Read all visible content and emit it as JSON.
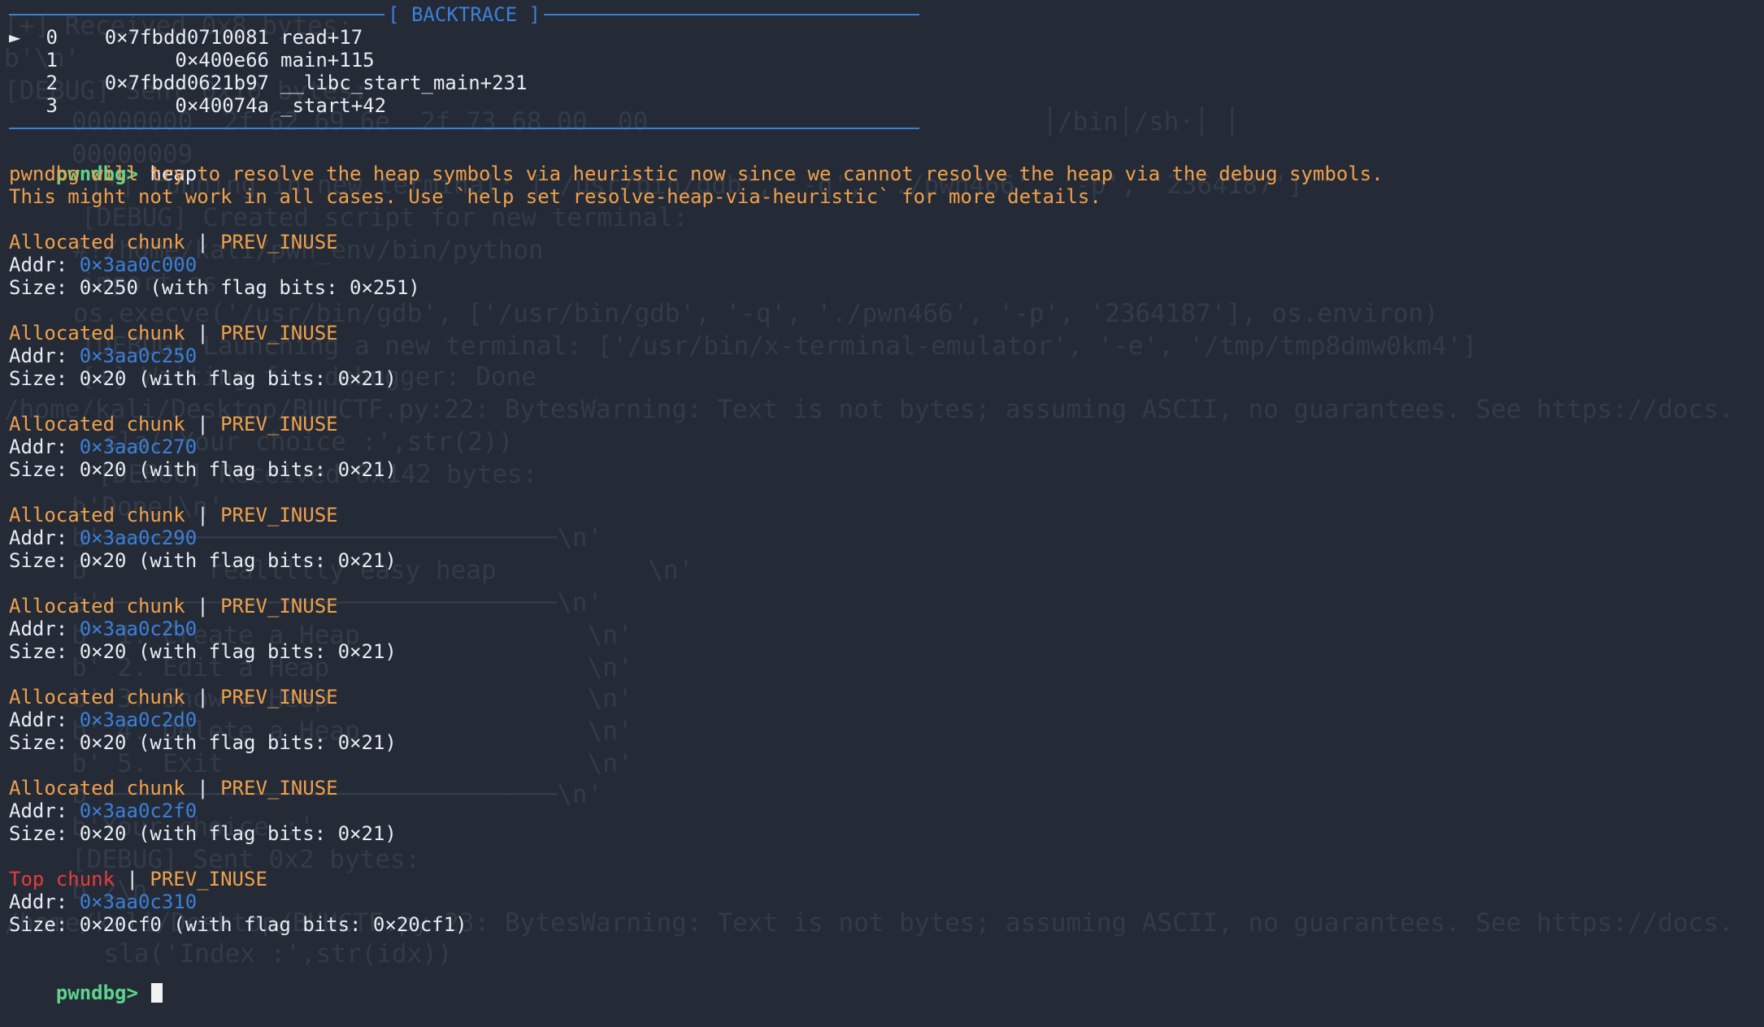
{
  "ghost_lines": [
    "[+] Received 0x8 bytes:",
    "b'\\n'",
    "[DEBUG] Sent 0x10 bytes:",
    "00000000  2f 62 69 6e  2f 73 68 00  00                          │/bin│/sh·│ │",
    "00000009",
    "[*] running in new terminal: ['/usr/bin/gdb', '-q', './pwn466', '-p', '2364187']",
    "[DEBUG] Created script for new terminal:",
    "#!/home/kali/pwn_env/bin/python",
    "import os",
    "os.execve('/usr/bin/gdb', ['/usr/bin/gdb', '-q', './pwn466', '-p', '2364187'], os.environ)",
    "[DEBUG] Launching a new terminal: ['/usr/bin/x-terminal-emulator', '-e', '/tmp/tmp8dmw0km4']",
    "[+] Waiting for debugger: Done",
    "/home/kali/Desktop/BUUCTF.py:22: BytesWarning: Text is not bytes; assuming ASCII, no guarantees. See https://docs.",
    "  sla('Your choice :',str(2))",
    "[DEBUG] Received 0x142 bytes:",
    "b'Done!\\n'",
    "b'──────────────────────────────\\n'",
    "b'       reallllly easy heap          \\n'",
    "b'──────────────────────────────\\n'",
    "b' 1. Create a Heap               \\n'",
    "b' 2. Edit a Heap                 \\n'",
    "b' 3. Show a Heap                 \\n'",
    "b' 4. Delete a Heap               \\n'",
    "b' 5. Exit                        \\n'",
    "b'──────────────────────────────\\n'",
    "b'Your choice :'",
    "[DEBUG] Sent 0x2 bytes:",
    "b'2\\n'",
    "/home/kali/Desktop/BUUCTF.py:23: BytesWarning: Text is not bytes; assuming ASCII, no guarantees. See https://docs.",
    "  sla('Index :',str(idx))"
  ],
  "backtrace": {
    "title": "[ BACKTRACE ]",
    "frames": [
      {
        "marker": "►",
        "index": "0",
        "addr": "0×7fbdd0710081",
        "symbol": "read+17"
      },
      {
        "marker": "",
        "index": "1",
        "addr": "0×400e66",
        "symbol": "main+115"
      },
      {
        "marker": "",
        "index": "2",
        "addr": "0×7fbdd0621b97",
        "symbol": "__libc_start_main+231"
      },
      {
        "marker": "",
        "index": "3",
        "addr": "0×40074a",
        "symbol": "_start+42"
      }
    ]
  },
  "prompt": "pwndbg>",
  "command": "heap",
  "warning_lines": [
    "pwndbg will try to resolve the heap symbols via heuristic now since we cannot resolve the heap via the debug symbols.",
    "This might not work in all cases. Use `help set resolve-heap-via-heuristic` for more details."
  ],
  "chunks": [
    {
      "type": "Allocated chunk",
      "flag": "PREV_INUSE",
      "addr": "0×3aa0c000",
      "size": "Size: 0×250 (with flag bits: 0×251)"
    },
    {
      "type": "Allocated chunk",
      "flag": "PREV_INUSE",
      "addr": "0×3aa0c250",
      "size": "Size: 0×20 (with flag bits: 0×21)"
    },
    {
      "type": "Allocated chunk",
      "flag": "PREV_INUSE",
      "addr": "0×3aa0c270",
      "size": "Size: 0×20 (with flag bits: 0×21)"
    },
    {
      "type": "Allocated chunk",
      "flag": "PREV_INUSE",
      "addr": "0×3aa0c290",
      "size": "Size: 0×20 (with flag bits: 0×21)"
    },
    {
      "type": "Allocated chunk",
      "flag": "PREV_INUSE",
      "addr": "0×3aa0c2b0",
      "size": "Size: 0×20 (with flag bits: 0×21)"
    },
    {
      "type": "Allocated chunk",
      "flag": "PREV_INUSE",
      "addr": "0×3aa0c2d0",
      "size": "Size: 0×20 (with flag bits: 0×21)"
    },
    {
      "type": "Allocated chunk",
      "flag": "PREV_INUSE",
      "addr": "0×3aa0c2f0",
      "size": "Size: 0×20 (with flag bits: 0×21)"
    },
    {
      "type": "Top chunk",
      "flag": "PREV_INUSE",
      "addr": "0×3aa0c310",
      "size": "Size: 0×20cf0 (with flag bits: 0×20cf1)"
    }
  ],
  "addr_label": "Addr: ",
  "separator": " | ",
  "colors": {
    "background": "#242b37",
    "prompt": "#5fd38d",
    "warning": "#f0a04b",
    "address": "#3d7fd8",
    "top_chunk": "#e83b3b",
    "text": "#e8ecf2"
  }
}
